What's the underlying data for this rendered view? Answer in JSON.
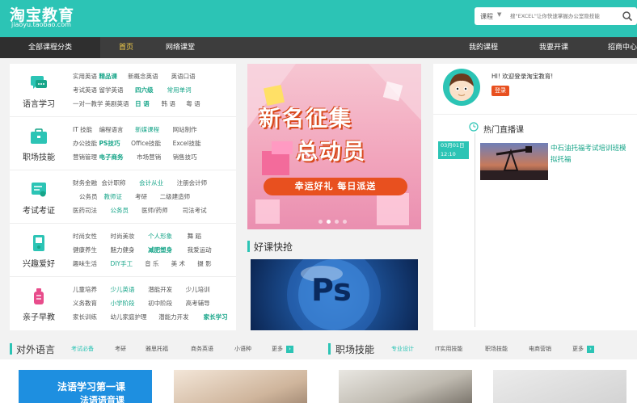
{
  "header": {
    "logo_main": "淘宝教育",
    "logo_sub": "jiaoyu.taobao.com",
    "search_category": "课程",
    "search_placeholder": "搜\"EXCEL\"让你快速掌握办公室隐技能"
  },
  "nav": {
    "all_courses": "全部课程分类",
    "items": [
      "首页",
      "网络课堂",
      "我的课程",
      "我要开课",
      "招商中心"
    ]
  },
  "categories": [
    {
      "name": "语言学习",
      "lines": [
        [
          "实用英语",
          "精品课",
          "新概念英语",
          "英语口语"
        ],
        [
          "考试英语",
          "留学英语",
          "四六级",
          "常用单词"
        ],
        [
          "一对一教学",
          "美剧英语",
          "日 语",
          "韩 语",
          "粤 语"
        ]
      ]
    },
    {
      "name": "职场技能",
      "lines": [
        [
          "IT 技能",
          "编程语言",
          "新媒课程",
          "网站制作"
        ],
        [
          "办公技能",
          "PS技巧",
          "Office技能",
          "Excel技能"
        ],
        [
          "营销管理",
          "电子商务",
          "市场营销",
          "销售技巧"
        ]
      ]
    },
    {
      "name": "考试考证",
      "lines": [
        [
          "财务金融",
          "会计职称",
          "会计从业",
          "注册会计师"
        ],
        [
          "公务员",
          "教师证",
          "考研",
          "二级建造师"
        ],
        [
          "医药司法",
          "公务员",
          "医师/药师",
          "司法考试"
        ]
      ]
    },
    {
      "name": "兴趣爱好",
      "lines": [
        [
          "时尚女性",
          "时尚美妆",
          "个人形象",
          "舞 蹈"
        ],
        [
          "健康养生",
          "魅力健身",
          "减肥塑身",
          "我爱运动"
        ],
        [
          "趣味生活",
          "DIY手工",
          "音 乐",
          "美 术",
          "摄 影"
        ]
      ]
    },
    {
      "name": "亲子早教",
      "lines": [
        [
          "儿童培养",
          "少儿英语",
          "潜能开发",
          "少儿培训"
        ],
        [
          "义务教育",
          "小学阶段",
          "初中阶段",
          "高考辅导"
        ],
        [
          "家长训练",
          "幼儿家庭护理",
          "潜能力开发",
          "家长学习"
        ]
      ]
    }
  ],
  "banner": {
    "line1": "新名征集",
    "line2": "总动员",
    "ribbon": "幸运好礼 每日派送"
  },
  "sections": {
    "hot_deals": "好课快抢"
  },
  "ps_image_text": "Ps",
  "user_panel": {
    "welcome": "HI! 欢迎登录淘宝教育!",
    "login": "登录"
  },
  "live": {
    "title": "热门直播课",
    "date": "03月01日",
    "time": "12:10",
    "desc": "中石油托福考试培训班模拟托福"
  },
  "tabs_left": {
    "title": "对外语言",
    "links": [
      "考试必备",
      "考研",
      "雅思托福",
      "商务英语",
      "小语种",
      "更多"
    ]
  },
  "tabs_right": {
    "title": "职场技能",
    "links": [
      "专业设计",
      "IT实用技能",
      "职场技能",
      "电商营销",
      "更多"
    ]
  },
  "cards": {
    "blue_line1": "法语学习第一课",
    "blue_line2": "法语语音课"
  },
  "colors": {
    "brand": "#2cc4b5",
    "nav_bg": "#3d3d3d",
    "accent_orange": "#e8501f",
    "highlight_green": "#17a589"
  }
}
